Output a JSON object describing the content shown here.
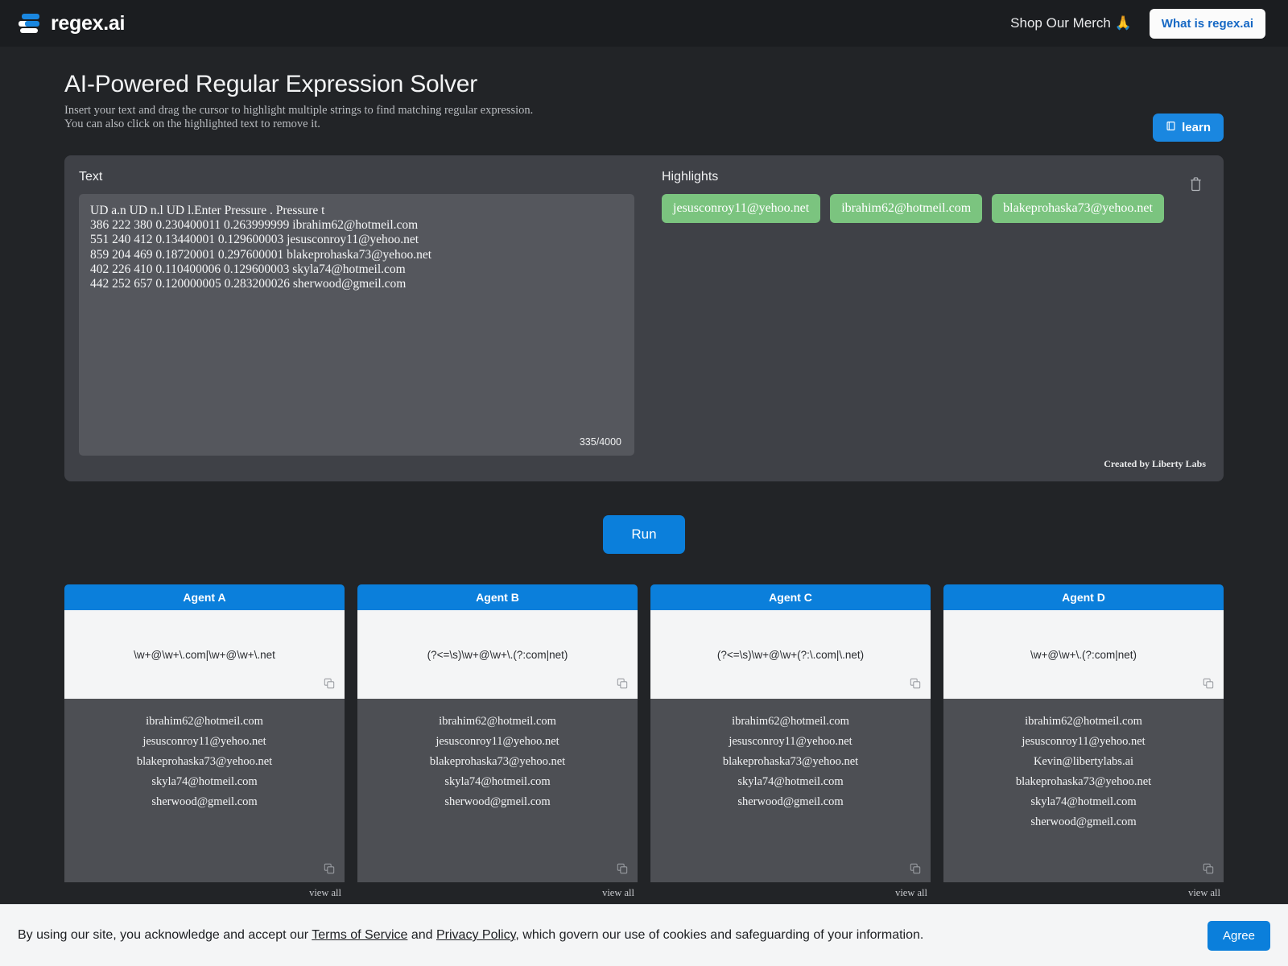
{
  "nav": {
    "brand": "regex.ai",
    "merch_label": "Shop Our Merch 🙏",
    "whatis_label": "What is regex.ai"
  },
  "hero": {
    "title": "AI-Powered Regular Expression Solver",
    "subtitle_line1": "Insert your text and drag the cursor to highlight multiple strings to find matching regular expression.",
    "subtitle_line2": "You can also click on the highlighted text to remove it.",
    "learn_label": "learn"
  },
  "panel": {
    "text_label": "Text",
    "highlights_label": "Highlights",
    "text_lines": [
      "UD a.n UD n.l UD l.Enter Pressure . Pressure t",
      "386 222 380 0.230400011 0.263999999 ibrahim62@hotmeil.com",
      "551 240 412 0.13440001 0.129600003 jesusconroy11@yehoo.net",
      "859 204 469 0.18720001 0.297600001 blakeprohaska73@yehoo.net",
      "402 226 410 0.110400006 0.129600003 skyla74@hotmeil.com",
      "442 252 657 0.120000005 0.283200026 sherwood@gmeil.com"
    ],
    "char_count": "335/4000",
    "highlights": [
      "jesusconroy11@yehoo.net",
      "ibrahim62@hotmeil.com",
      "blakeprohaska73@yehoo.net"
    ],
    "credit": "Created by Liberty Labs"
  },
  "run_label": "Run",
  "view_all_label": "view all",
  "agents": [
    {
      "name": "Agent A",
      "regex": "\\w+@\\w+\\.com|\\w+@\\w+\\.net",
      "results": [
        "ibrahim62@hotmeil.com",
        "jesusconroy11@yehoo.net",
        "blakeprohaska73@yehoo.net",
        "skyla74@hotmeil.com",
        "sherwood@gmeil.com"
      ]
    },
    {
      "name": "Agent B",
      "regex": "(?<=\\s)\\w+@\\w+\\.(?:com|net)",
      "results": [
        "ibrahim62@hotmeil.com",
        "jesusconroy11@yehoo.net",
        "blakeprohaska73@yehoo.net",
        "skyla74@hotmeil.com",
        "sherwood@gmeil.com"
      ]
    },
    {
      "name": "Agent C",
      "regex": "(?<=\\s)\\w+@\\w+(?:\\.com|\\.net)",
      "results": [
        "ibrahim62@hotmeil.com",
        "jesusconroy11@yehoo.net",
        "blakeprohaska73@yehoo.net",
        "skyla74@hotmeil.com",
        "sherwood@gmeil.com"
      ]
    },
    {
      "name": "Agent D",
      "regex": "\\w+@\\w+\\.(?:com|net)",
      "results": [
        "ibrahim62@hotmeil.com",
        "jesusconroy11@yehoo.net",
        "Kevin@libertylabs.ai",
        "blakeprohaska73@yehoo.net",
        "skyla74@hotmeil.com",
        "sherwood@gmeil.com"
      ]
    }
  ],
  "cookie": {
    "text_before": "By using our site, you acknowledge and accept our ",
    "link_tos": "Terms of Service",
    "text_mid": " and ",
    "link_privacy": "Privacy Policy",
    "text_after": ", which govern our use of cookies and safeguarding of your information.",
    "agree_label": "Agree"
  },
  "colors": {
    "accent_blue": "#0b7fdb",
    "highlight_green": "#7bc47f",
    "page_bg": "#222427",
    "panel_bg": "#3f4147"
  }
}
